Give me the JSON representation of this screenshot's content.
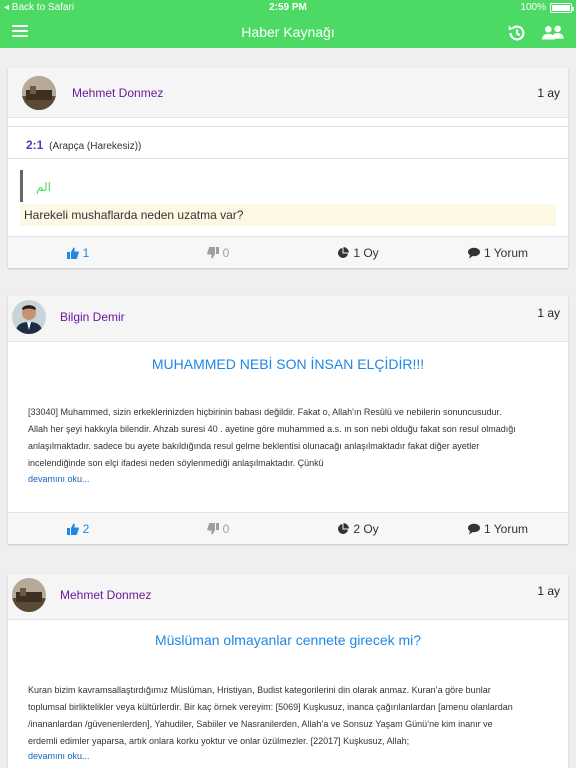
{
  "status_bar": {
    "back_label": "◂ Back to Safari",
    "time": "2:59 PM",
    "battery": "100%",
    "battery_level": 1.0
  },
  "navbar": {
    "title": "Haber Kaynağı"
  },
  "colors": {
    "accent": "#4cd964",
    "author": "#6a1b9a",
    "link": "#1e88e5",
    "verse_bg": "#fcf8e3"
  },
  "posts": [
    {
      "author": "Mehmet Donmez",
      "time": "1 ay",
      "verse_number": "2:1",
      "verse_note": "(Arapça (Harekesiz))",
      "arabic": "الم",
      "question": "Harekeli mushaflarda neden uzatma var?",
      "likes": "1",
      "dislikes": "0",
      "votes": "1 Oy",
      "comments": "1 Yorum"
    },
    {
      "author": "Bilgin Demir",
      "time": "1 ay",
      "title": "MUHAMMED NEBİ SON İNSAN ELÇİDİR!!!",
      "body_lines": [
        "[33040] Muhammed, sizin erkeklerinizden hiçbirinin babası değildir. Fakat o, Allah'ın Resûlü ve nebilerin sonuncusudur.",
        "Allah her şeyi hakkıyla bilendir. Ahzab suresi 40 . ayetine göre muhammed a.s. ın son nebi olduğu fakat son resul olmadığı",
        "anlaşılmaktadır. sadece bu ayete bakıldığında resul gelme beklentisi olunacağı anlaşılmaktadır fakat diğer ayetler",
        "incelendiğinde son elçi ifadesi  neden söylenmediği anlaşılmaktadır. Çünkü"
      ],
      "more": "devamını oku...",
      "likes": "2",
      "dislikes": "0",
      "votes": "2 Oy",
      "comments": "1 Yorum"
    },
    {
      "author": "Mehmet Donmez",
      "time": "1 ay",
      "title": "Müslüman olmayanlar cennete girecek mi?",
      "body_lines": [
        "Kuran bizim kavramsallaştırdığımız Müslüman, Hristiyan, Budist kategorilerini din olarak anmaz. Kuran’a göre bunlar",
        "toplumsal birliktelikler veya kültürlerdir. Bir kaç örnek vereyim: [5069] Kuşkusuz, inanca çağırılanlardan [amenu olanlardan",
        "/inananlardan /güvenenlerden], Yahudiler, Sabiiler ve Nasranilerden, Allah’a ve Sonsuz Yaşam Günü’ne kim inanır ve",
        "erdemli edimler yaparsa, artık onlara korku yoktur ve onlar üzülmezler. [22017] Kuşkusuz, Allah;"
      ],
      "more": "devamını oku..."
    }
  ]
}
